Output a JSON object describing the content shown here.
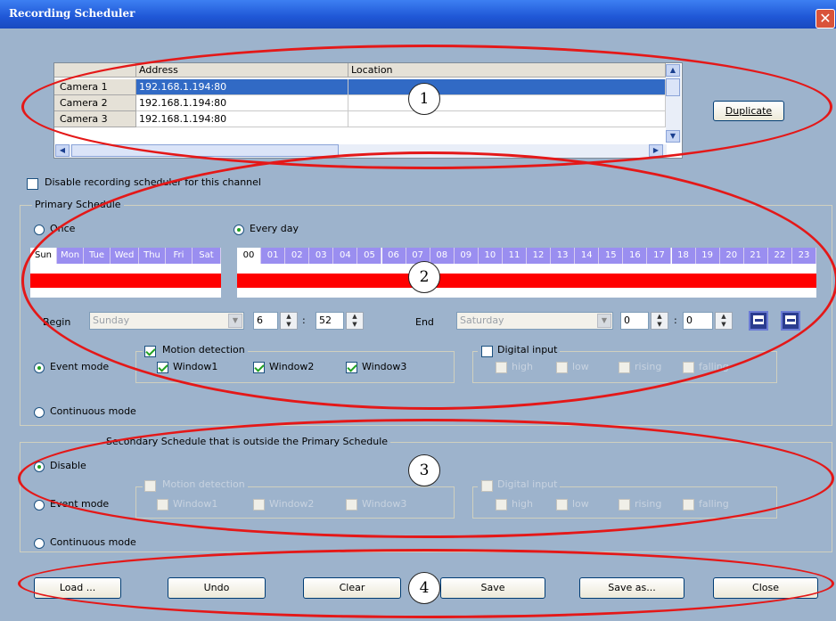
{
  "window": {
    "title": "Recording Scheduler",
    "close_glyph": "✕"
  },
  "camera_table": {
    "columns": [
      "",
      "Address",
      "Location"
    ],
    "rows": [
      {
        "name": "Camera  1",
        "address": "192.168.1.194:80",
        "location": ""
      },
      {
        "name": "Camera  2",
        "address": "192.168.1.194:80",
        "location": ""
      },
      {
        "name": "Camera  3",
        "address": "192.168.1.194:80",
        "location": ""
      }
    ],
    "selected_row": 0
  },
  "duplicate_button": "Duplicate",
  "disable_channel_label": "Disable recording scheduler for this channel",
  "primary": {
    "group_title": "Primary Schedule",
    "once_label": "Once",
    "everyday_label": "Every day",
    "days": [
      "Sun",
      "Mon",
      "Tue",
      "Wed",
      "Thu",
      "Fri",
      "Sat"
    ],
    "hours": [
      "00",
      "01",
      "02",
      "03",
      "04",
      "05",
      "06",
      "07",
      "08",
      "09",
      "10",
      "11",
      "12",
      "13",
      "14",
      "15",
      "16",
      "17",
      "18",
      "19",
      "20",
      "21",
      "22",
      "23"
    ],
    "begin_label": "Begin",
    "begin_day": "Sunday",
    "begin_hour": "6",
    "begin_min": "52",
    "end_label": "End",
    "end_day": "Saturday",
    "end_hour": "0",
    "end_min": "0",
    "event_mode_label": "Event mode",
    "continuous_label": "Continuous mode",
    "motion_label": "Motion detection",
    "windows": [
      "Window1",
      "Window2",
      "Window3"
    ],
    "digital_label": "Digital input",
    "digital_opts": [
      "high",
      "low",
      "rising",
      "falling"
    ]
  },
  "secondary": {
    "group_title": "Secondary Schedule that is outside the Primary Schedule",
    "disable_label": "Disable",
    "event_mode_label": "Event mode",
    "continuous_label": "Continuous mode",
    "motion_label": "Motion detection",
    "windows": [
      "Window1",
      "Window2",
      "Window3"
    ],
    "digital_label": "Digital input",
    "digital_opts": [
      "high",
      "low",
      "rising",
      "falling"
    ]
  },
  "buttons": {
    "load": "Load ...",
    "undo": "Undo",
    "clear": "Clear",
    "save": "Save",
    "save_as": "Save as...",
    "close": "Close"
  },
  "annotations": [
    "1",
    "2",
    "3",
    "4"
  ],
  "colors": {
    "title_bar": "#1f57d6",
    "background": "#9db3cc",
    "selected_row": "#316ac5",
    "schedule_bar": "#ff0000",
    "day_header": "#9a8ef0",
    "annotation": "#e41818"
  }
}
